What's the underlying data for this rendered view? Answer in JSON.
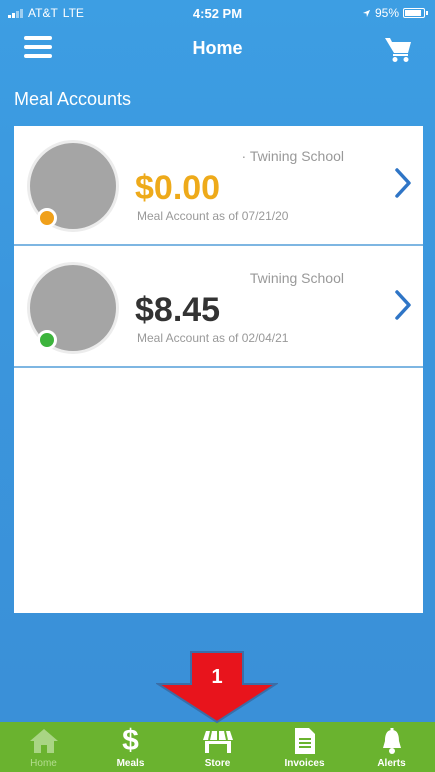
{
  "status_bar": {
    "carrier": "AT&T",
    "network": "LTE",
    "time": "4:52 PM",
    "battery": "95%",
    "battery_level": 0.95
  },
  "header": {
    "title": "Home",
    "menu_icon": "hamburger-menu-icon",
    "cart_icon": "shopping-cart-icon"
  },
  "section": {
    "title": "Meal Accounts"
  },
  "accounts": [
    {
      "school": "· Twining School",
      "balance": "$0.00",
      "as_of": "Meal Account as of 07/21/20",
      "balance_color": "#eeaa1a",
      "status_color": "#f0a01a"
    },
    {
      "school": "Twining School",
      "balance": "$8.45",
      "as_of": "Meal Account as of 02/04/21",
      "balance_color": "#333333",
      "status_color": "#3cb43c"
    }
  ],
  "tabs": [
    {
      "label": "Home",
      "icon": "home-icon",
      "active": false
    },
    {
      "label": "Meals",
      "icon": "dollar-icon",
      "active": true
    },
    {
      "label": "Store",
      "icon": "store-icon",
      "active": true
    },
    {
      "label": "Invoices",
      "icon": "document-icon",
      "active": true
    },
    {
      "label": "Alerts",
      "icon": "bell-icon",
      "active": true
    }
  ],
  "annotation": {
    "number": "1",
    "color": "#e8141c"
  },
  "colors": {
    "background": "#3b96dd",
    "tab_bar": "#6ab32f",
    "chevron": "#2f75c6"
  }
}
